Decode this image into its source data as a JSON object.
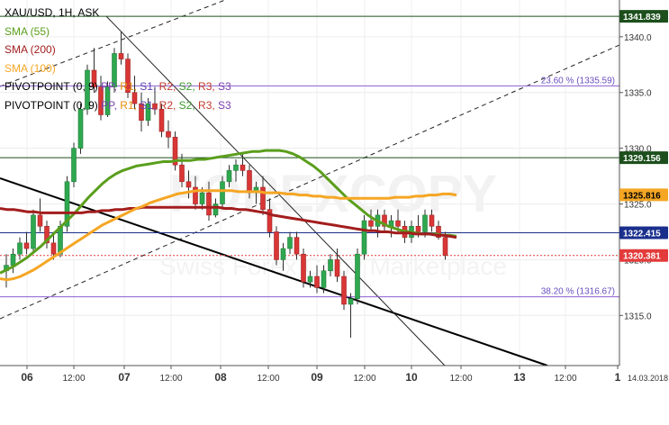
{
  "chart_data": {
    "type": "candlestick",
    "title": "XAU/USD, 1H, ASK",
    "legend": [
      {
        "text": "SMA (55)",
        "color": "#5a9e1c"
      },
      {
        "text": "SMA (200)",
        "color": "#a31d1d"
      },
      {
        "text": "SMA (100)",
        "color": "#f5a623"
      }
    ],
    "pivot_labels": [
      {
        "prefix": "PIVOTPOINT (0, 9)",
        "items": [
          {
            "t": "PP",
            "c": "#7b3fb2"
          },
          {
            "t": "R1",
            "c": "#e8900c"
          },
          {
            "t": "S1",
            "c": "#5a3fb2"
          },
          {
            "t": "R2",
            "c": "#c0392b"
          },
          {
            "t": "S2",
            "c": "#3c9a2d"
          },
          {
            "t": "R3",
            "c": "#c0392b"
          },
          {
            "t": "S3",
            "c": "#7b3fb2"
          }
        ]
      },
      {
        "prefix": "PIVOTPOINT (0, 9)",
        "items": [
          {
            "t": "PP",
            "c": "#7b3fb2"
          },
          {
            "t": "R1",
            "c": "#e8900c"
          },
          {
            "t": "S1",
            "c": "#5a3fb2"
          },
          {
            "t": "R2",
            "c": "#c0392b"
          },
          {
            "t": "S2",
            "c": "#3c9a2d"
          },
          {
            "t": "R3",
            "c": "#c0392b"
          },
          {
            "t": "S3",
            "c": "#7b3fb2"
          }
        ]
      }
    ],
    "y_range": [
      1310.5,
      1343.3
    ],
    "y_ticks": [
      1315,
      1320,
      1325,
      1330,
      1335,
      1340
    ],
    "x_ticks": [
      "06",
      "12:00",
      "07",
      "12:00",
      "08",
      "12:00",
      "09",
      "12:00",
      "10",
      "12:00",
      "13",
      "12:00",
      "1"
    ],
    "x_end_label": "14.03.2018",
    "watermark": "FOREXCOPY",
    "watermark_sub": "Swiss Forex Copy Marketplace",
    "price_badges": [
      {
        "value": 1341.839,
        "label": "1341.839",
        "bg": "#1c4f1c",
        "fg": "#ffffff"
      },
      {
        "value": 1329.156,
        "label": "1329.156",
        "bg": "#1c4f1c",
        "fg": "#ffffff"
      },
      {
        "value": 1325.816,
        "label": "1325.816",
        "bg": "#f5a623",
        "fg": "#000000"
      },
      {
        "value": 1322.415,
        "label": "1322.415",
        "bg": "#1a2f8c",
        "fg": "#ffffff"
      },
      {
        "value": 1320.381,
        "label": "1320.381",
        "bg": "#e33b3b",
        "fg": "#ffffff"
      }
    ],
    "horizontal_lines": [
      {
        "value": 1341.839,
        "color": "#1c4f1c",
        "dash": ""
      },
      {
        "value": 1335.59,
        "color": "#8b5fcf",
        "dash": ""
      },
      {
        "value": 1329.156,
        "color": "#1c4f1c",
        "dash": ""
      },
      {
        "value": 1322.415,
        "color": "#1a2f8c",
        "dash": ""
      },
      {
        "value": 1320.381,
        "color": "#e33b3b",
        "dash": "2,2"
      },
      {
        "value": 1316.67,
        "color": "#8b5fcf",
        "dash": ""
      }
    ],
    "fib_labels": [
      {
        "value": 1335.59,
        "text": "23.60 % (1335.59)"
      },
      {
        "value": 1316.67,
        "text": "38.20 % (1316.67)"
      }
    ],
    "series": [
      {
        "name": "SMA (55)",
        "color": "#5a9e1c",
        "values": [
          1318.8,
          1319.1,
          1319.4,
          1319.8,
          1320.2,
          1320.7,
          1321.2,
          1321.8,
          1322.4,
          1323.0,
          1323.6,
          1324.2,
          1324.9,
          1325.6,
          1326.2,
          1326.8,
          1327.3,
          1327.7,
          1328.0,
          1328.2,
          1328.4,
          1328.5,
          1328.6,
          1328.7,
          1328.8,
          1328.8,
          1328.9,
          1328.9,
          1328.9,
          1329.0,
          1329.0,
          1329.1,
          1329.2,
          1329.3,
          1329.4,
          1329.5,
          1329.6,
          1329.7,
          1329.7,
          1329.8,
          1329.8,
          1329.8,
          1329.7,
          1329.5,
          1329.2,
          1328.8,
          1328.4,
          1327.9,
          1327.3,
          1326.7,
          1326.1,
          1325.5,
          1325.0,
          1324.5,
          1324.0,
          1323.6,
          1323.3,
          1323.0,
          1322.8,
          1322.6,
          1322.5,
          1322.4,
          1322.3,
          1322.3,
          1322.3,
          1322.2,
          1322.2,
          1322.1
        ]
      },
      {
        "name": "SMA (200)",
        "color": "#a31d1d",
        "values": [
          1324.6,
          1324.5,
          1324.5,
          1324.4,
          1324.3,
          1324.3,
          1324.2,
          1324.2,
          1324.2,
          1324.2,
          1324.2,
          1324.2,
          1324.2,
          1324.3,
          1324.3,
          1324.4,
          1324.4,
          1324.5,
          1324.5,
          1324.6,
          1324.6,
          1324.7,
          1324.7,
          1324.7,
          1324.7,
          1324.7,
          1324.7,
          1324.7,
          1324.7,
          1324.7,
          1324.7,
          1324.7,
          1324.7,
          1324.6,
          1324.6,
          1324.5,
          1324.5,
          1324.4,
          1324.3,
          1324.2,
          1324.0,
          1323.9,
          1323.8,
          1323.7,
          1323.6,
          1323.5,
          1323.4,
          1323.3,
          1323.2,
          1323.1,
          1323.0,
          1322.9,
          1322.8,
          1322.7,
          1322.6,
          1322.6,
          1322.5,
          1322.5,
          1322.4,
          1322.4,
          1322.4,
          1322.3,
          1322.3,
          1322.3,
          1322.2,
          1322.2,
          1322.1,
          1322.0
        ]
      },
      {
        "name": "SMA (100)",
        "color": "#f5a623",
        "values": [
          1318.3,
          1318.2,
          1318.3,
          1318.5,
          1318.8,
          1319.1,
          1319.5,
          1319.9,
          1320.3,
          1320.7,
          1321.1,
          1321.5,
          1321.9,
          1322.3,
          1322.7,
          1323.1,
          1323.4,
          1323.7,
          1324.0,
          1324.3,
          1324.6,
          1324.8,
          1325.1,
          1325.3,
          1325.5,
          1325.7,
          1325.9,
          1326.0,
          1326.1,
          1326.2,
          1326.2,
          1326.2,
          1326.2,
          1326.2,
          1326.2,
          1326.1,
          1326.1,
          1326.1,
          1326.1,
          1326.0,
          1326.0,
          1326.0,
          1325.9,
          1325.9,
          1325.8,
          1325.8,
          1325.7,
          1325.7,
          1325.6,
          1325.6,
          1325.5,
          1325.5,
          1325.5,
          1325.5,
          1325.5,
          1325.5,
          1325.5,
          1325.5,
          1325.6,
          1325.6,
          1325.6,
          1325.7,
          1325.7,
          1325.8,
          1325.8,
          1325.9,
          1325.9,
          1325.8
        ]
      }
    ],
    "candles": [
      [
        1319.0,
        1320.5,
        1317.5,
        1319.5
      ],
      [
        1319.5,
        1321.0,
        1318.8,
        1320.5
      ],
      [
        1320.5,
        1322.0,
        1320.0,
        1321.5
      ],
      [
        1321.5,
        1322.5,
        1320.5,
        1321.0
      ],
      [
        1321.0,
        1324.5,
        1320.8,
        1324.0
      ],
      [
        1324.0,
        1325.5,
        1322.5,
        1323.0
      ],
      [
        1323.0,
        1323.5,
        1321.0,
        1321.5
      ],
      [
        1321.5,
        1322.5,
        1320.0,
        1320.5
      ],
      [
        1320.5,
        1323.5,
        1320.2,
        1323.0
      ],
      [
        1323.0,
        1327.5,
        1322.5,
        1327.0
      ],
      [
        1327.0,
        1330.5,
        1326.5,
        1330.0
      ],
      [
        1330.0,
        1334.0,
        1329.5,
        1333.5
      ],
      [
        1333.5,
        1337.5,
        1333.0,
        1337.0
      ],
      [
        1337.0,
        1339.0,
        1335.0,
        1335.5
      ],
      [
        1335.5,
        1336.5,
        1332.5,
        1333.0
      ],
      [
        1333.0,
        1336.0,
        1332.8,
        1335.5
      ],
      [
        1335.5,
        1339.0,
        1335.0,
        1338.5
      ],
      [
        1338.5,
        1340.5,
        1337.5,
        1338.0
      ],
      [
        1338.0,
        1338.5,
        1334.5,
        1335.0
      ],
      [
        1335.0,
        1336.5,
        1333.5,
        1334.0
      ],
      [
        1334.0,
        1335.0,
        1331.5,
        1332.5
      ],
      [
        1332.5,
        1334.5,
        1332.0,
        1334.0
      ],
      [
        1334.0,
        1335.5,
        1333.0,
        1333.5
      ],
      [
        1333.5,
        1334.0,
        1331.0,
        1331.5
      ],
      [
        1331.5,
        1332.5,
        1330.0,
        1331.0
      ],
      [
        1331.0,
        1331.5,
        1328.0,
        1328.5
      ],
      [
        1328.5,
        1329.5,
        1326.5,
        1327.0
      ],
      [
        1327.0,
        1328.0,
        1325.5,
        1326.5
      ],
      [
        1326.5,
        1327.5,
        1324.5,
        1325.0
      ],
      [
        1325.0,
        1326.5,
        1324.5,
        1326.0
      ],
      [
        1326.0,
        1327.0,
        1323.5,
        1324.0
      ],
      [
        1324.0,
        1325.5,
        1323.8,
        1325.0
      ],
      [
        1325.0,
        1327.5,
        1324.5,
        1327.0
      ],
      [
        1327.0,
        1328.5,
        1326.5,
        1328.0
      ],
      [
        1328.0,
        1329.0,
        1327.0,
        1328.5
      ],
      [
        1328.5,
        1329.5,
        1327.5,
        1328.0
      ],
      [
        1328.0,
        1328.5,
        1325.5,
        1326.0
      ],
      [
        1326.0,
        1327.0,
        1325.0,
        1326.5
      ],
      [
        1326.5,
        1327.5,
        1324.0,
        1324.5
      ],
      [
        1324.5,
        1325.5,
        1322.0,
        1322.5
      ],
      [
        1322.5,
        1323.0,
        1319.5,
        1320.0
      ],
      [
        1320.0,
        1321.5,
        1319.0,
        1321.0
      ],
      [
        1321.0,
        1322.5,
        1320.5,
        1322.0
      ],
      [
        1322.0,
        1322.5,
        1320.0,
        1320.5
      ],
      [
        1320.5,
        1321.0,
        1317.5,
        1318.0
      ],
      [
        1318.0,
        1319.0,
        1317.5,
        1318.5
      ],
      [
        1318.5,
        1319.5,
        1317.0,
        1317.5
      ],
      [
        1317.5,
        1319.5,
        1317.0,
        1319.0
      ],
      [
        1319.0,
        1320.5,
        1318.5,
        1320.0
      ],
      [
        1320.0,
        1321.0,
        1318.0,
        1318.5
      ],
      [
        1318.5,
        1319.0,
        1315.5,
        1316.0
      ],
      [
        1316.0,
        1317.0,
        1313.0,
        1316.5
      ],
      [
        1316.5,
        1321.0,
        1316.0,
        1320.5
      ],
      [
        1320.5,
        1324.0,
        1320.0,
        1323.5
      ],
      [
        1323.5,
        1324.5,
        1322.5,
        1323.0
      ],
      [
        1323.0,
        1324.5,
        1322.0,
        1324.0
      ],
      [
        1324.0,
        1324.5,
        1322.5,
        1323.0
      ],
      [
        1323.0,
        1324.0,
        1322.0,
        1323.5
      ],
      [
        1323.5,
        1324.5,
        1322.5,
        1323.0
      ],
      [
        1323.0,
        1323.5,
        1321.5,
        1322.0
      ],
      [
        1322.0,
        1323.5,
        1321.5,
        1323.0
      ],
      [
        1323.0,
        1324.0,
        1322.0,
        1322.5
      ],
      [
        1322.5,
        1324.5,
        1322.0,
        1324.0
      ],
      [
        1324.0,
        1324.5,
        1322.5,
        1323.0
      ],
      [
        1323.0,
        1323.5,
        1321.8,
        1322.0
      ],
      [
        1322.0,
        1322.5,
        1320.0,
        1320.4
      ]
    ]
  }
}
